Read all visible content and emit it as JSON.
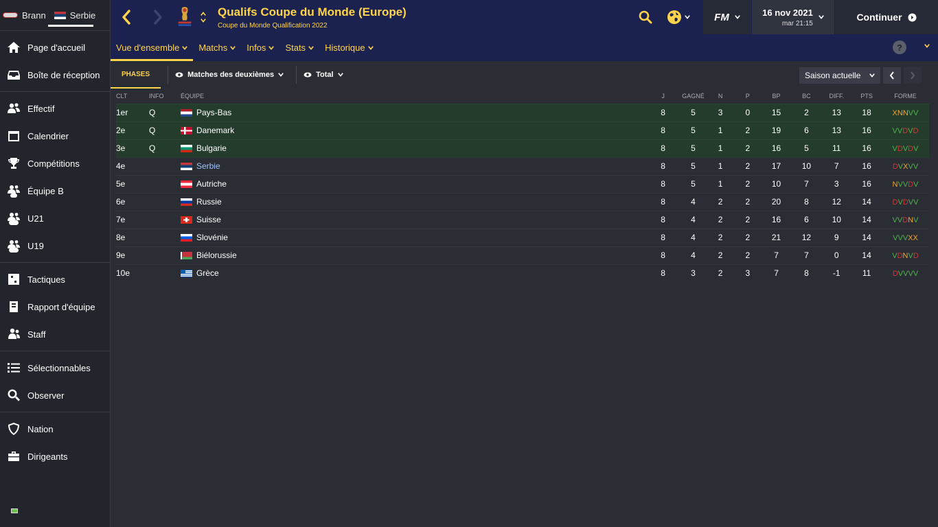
{
  "sidebar": {
    "club1": "Brann",
    "club2": "Serbie",
    "groups": [
      [
        {
          "label": "Page d'accueil",
          "icon": "home-icon"
        },
        {
          "label": "Boîte de réception",
          "icon": "inbox-icon"
        }
      ],
      [
        {
          "label": "Effectif",
          "icon": "squad-icon"
        },
        {
          "label": "Calendrier",
          "icon": "calendar-icon"
        },
        {
          "label": "Compétitions",
          "icon": "trophy-icon"
        },
        {
          "label": "Équipe B",
          "icon": "team-b-icon"
        },
        {
          "label": "U21",
          "icon": "u21-icon"
        },
        {
          "label": "U19",
          "icon": "u19-icon"
        }
      ],
      [
        {
          "label": "Tactiques",
          "icon": "tactics-icon"
        },
        {
          "label": "Rapport d'équipe",
          "icon": "report-icon"
        },
        {
          "label": "Staff",
          "icon": "staff-icon"
        }
      ],
      [
        {
          "label": "Sélectionnables",
          "icon": "list-icon"
        },
        {
          "label": "Observer",
          "icon": "search-icon"
        }
      ],
      [
        {
          "label": "Nation",
          "icon": "shield-icon"
        },
        {
          "label": "Dirigeants",
          "icon": "briefcase-icon"
        }
      ]
    ]
  },
  "header": {
    "title": "Qualifs Coupe du Monde (Europe)",
    "subtitle": "Coupe du Monde Qualification 2022",
    "fm_label": "FM",
    "date": "16 nov 2021",
    "day_time": "mar 21:15",
    "continue_label": "Continuer",
    "help_label": "?"
  },
  "subnav": [
    {
      "label": "Vue d'ensemble",
      "active": true
    },
    {
      "label": "Matchs"
    },
    {
      "label": "Infos"
    },
    {
      "label": "Stats"
    },
    {
      "label": "Historique"
    }
  ],
  "toolbar": {
    "phases_label": "PHASES",
    "view_label": "Matches des deuxièmes",
    "total_label": "Total",
    "season_label": "Saison actuelle"
  },
  "table": {
    "headers": [
      "CLT",
      "INFO",
      "ÉQUIPE",
      "J",
      "GAGNÉ",
      "N",
      "P",
      "BP",
      "BC",
      "DIFF.",
      "PTS",
      "FORME"
    ],
    "rows": [
      {
        "pos": "1er",
        "info": "Q",
        "team": "Pays-Bas",
        "flag": "nl",
        "j": "8",
        "g": "5",
        "n": "3",
        "p": "0",
        "bp": "15",
        "bc": "2",
        "diff": "13",
        "pts": "18",
        "form": "XNNVV"
      },
      {
        "pos": "2e",
        "info": "Q",
        "team": "Danemark",
        "flag": "dk",
        "j": "8",
        "g": "5",
        "n": "1",
        "p": "2",
        "bp": "19",
        "bc": "6",
        "diff": "13",
        "pts": "16",
        "form": "VVDVD"
      },
      {
        "pos": "3e",
        "info": "Q",
        "team": "Bulgarie",
        "flag": "bg",
        "j": "8",
        "g": "5",
        "n": "1",
        "p": "2",
        "bp": "16",
        "bc": "5",
        "diff": "11",
        "pts": "16",
        "form": "VDVDV"
      },
      {
        "pos": "4e",
        "info": "",
        "team": "Serbie",
        "flag": "rs",
        "j": "8",
        "g": "5",
        "n": "1",
        "p": "2",
        "bp": "17",
        "bc": "10",
        "diff": "7",
        "pts": "16",
        "form": "DVXVV",
        "highlight": true
      },
      {
        "pos": "5e",
        "info": "",
        "team": "Autriche",
        "flag": "at",
        "j": "8",
        "g": "5",
        "n": "1",
        "p": "2",
        "bp": "10",
        "bc": "7",
        "diff": "3",
        "pts": "16",
        "form": "NVVDV"
      },
      {
        "pos": "6e",
        "info": "",
        "team": "Russie",
        "flag": "ru",
        "j": "8",
        "g": "4",
        "n": "2",
        "p": "2",
        "bp": "20",
        "bc": "8",
        "diff": "12",
        "pts": "14",
        "form": "DVDVV"
      },
      {
        "pos": "7e",
        "info": "",
        "team": "Suisse",
        "flag": "ch",
        "j": "8",
        "g": "4",
        "n": "2",
        "p": "2",
        "bp": "16",
        "bc": "6",
        "diff": "10",
        "pts": "14",
        "form": "VVDNV"
      },
      {
        "pos": "8e",
        "info": "",
        "team": "Slovénie",
        "flag": "si",
        "j": "8",
        "g": "4",
        "n": "2",
        "p": "2",
        "bp": "21",
        "bc": "12",
        "diff": "9",
        "pts": "14",
        "form": "VVVXX"
      },
      {
        "pos": "9e",
        "info": "",
        "team": "Biélorussie",
        "flag": "by",
        "j": "8",
        "g": "4",
        "n": "2",
        "p": "2",
        "bp": "7",
        "bc": "7",
        "diff": "0",
        "pts": "14",
        "form": "VDNVD"
      },
      {
        "pos": "10e",
        "info": "",
        "team": "Grèce",
        "flag": "gr",
        "j": "8",
        "g": "3",
        "n": "2",
        "p": "3",
        "bp": "7",
        "bc": "8",
        "diff": "-1",
        "pts": "11",
        "form": "DVVVV"
      }
    ]
  },
  "colors": {
    "accent": "#ffd44a",
    "header_bg": "#1c2250",
    "qualified_row": "#243c2c",
    "form_win": "#4fb34a",
    "form_loss": "#d93434",
    "form_draw": "#f2a531"
  }
}
